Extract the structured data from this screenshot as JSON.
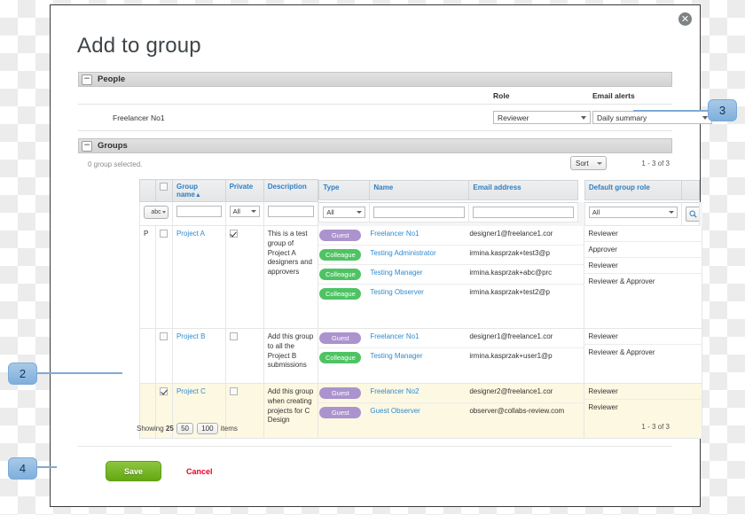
{
  "dialog": {
    "title": "Add to group",
    "close_icon": "close-icon"
  },
  "people": {
    "section_title": "People",
    "collapse_glyph": "−",
    "role_label": "Role",
    "alerts_label": "Email alerts",
    "person_name": "Freelancer No1",
    "role_value": "Reviewer",
    "alerts_value": "Daily summary"
  },
  "groups": {
    "section_title": "Groups",
    "collapse_glyph": "−",
    "selected_text": "0 group selected.",
    "sort_label": "Sort",
    "range_top": "1 - 3 of 3",
    "range_bottom": "1 - 3 of 3",
    "columns": {
      "group_name": "Group name",
      "sort_arrow": "▲",
      "private": "Private",
      "description": "Description",
      "type": "Type",
      "name": "Name",
      "email": "Email address",
      "default_role": "Default group role"
    },
    "filters": {
      "abc": "abc",
      "group_name": "",
      "private": "All",
      "description": "",
      "type": "All",
      "name": "",
      "email": "",
      "default_role": "All",
      "search_icon": "search-icon"
    },
    "rows": [
      {
        "indicator": "P",
        "selected": false,
        "name": "Project A",
        "private": true,
        "description": "This is a test group of Project A designers and approvers",
        "highlight": false,
        "members": [
          {
            "type": "Guest",
            "type_class": "guest",
            "name": "Freelancer No1",
            "email": "designer1@freelance1.cor",
            "role": "Reviewer"
          },
          {
            "type": "Colleague",
            "type_class": "colleague",
            "name": "Testing Administrator",
            "email": "irmina.kasprzak+test3@p",
            "role": "Approver"
          },
          {
            "type": "Colleague",
            "type_class": "colleague",
            "name": "Testing Manager",
            "email": "irmina.kasprzak+abc@prc",
            "role": "Reviewer"
          },
          {
            "type": "Colleague",
            "type_class": "colleague",
            "name": "Testing Observer",
            "email": "irmina.kasprzak+test2@p",
            "role": "Reviewer & Approver"
          }
        ]
      },
      {
        "indicator": "",
        "selected": false,
        "name": "Project B",
        "private": false,
        "description": "Add this group to all the Project B submissions",
        "highlight": false,
        "members": [
          {
            "type": "Guest",
            "type_class": "guest",
            "name": "Freelancer No1",
            "email": "designer1@freelance1.cor",
            "role": "Reviewer"
          },
          {
            "type": "Colleague",
            "type_class": "colleague",
            "name": "Testing Manager",
            "email": "irmina.kasprzak+user1@p",
            "role": "Reviewer & Approver"
          }
        ]
      },
      {
        "indicator": "",
        "selected": true,
        "name": "Project C",
        "private": false,
        "description": "Add this group when creating projects for C Design",
        "highlight": true,
        "members": [
          {
            "type": "Guest",
            "type_class": "guest",
            "name": "Freelancer No2",
            "email": "designer2@freelance1.cor",
            "role": "Reviewer"
          },
          {
            "type": "Guest",
            "type_class": "guest",
            "name": "Guest Observer",
            "email": "observer@collabs-review.com",
            "role": "Reviewer"
          }
        ]
      }
    ]
  },
  "footer": {
    "showing_label": "Showing",
    "page_size_current": "25",
    "page_size_50": "50",
    "page_size_100": "100",
    "items_label": "items",
    "save_label": "Save",
    "cancel_label": "Cancel"
  },
  "callouts": {
    "two": "2",
    "three": "3",
    "four": "4"
  },
  "colors": {
    "accent_link": "#2f8bcf",
    "guest_badge": "#ab93cd",
    "colleague_badge": "#4fc364",
    "save_green": "#8dc63f",
    "cancel_red": "#e4002b",
    "callout_blue": "#7fafdc",
    "row_highlight": "#fdf8e2"
  }
}
